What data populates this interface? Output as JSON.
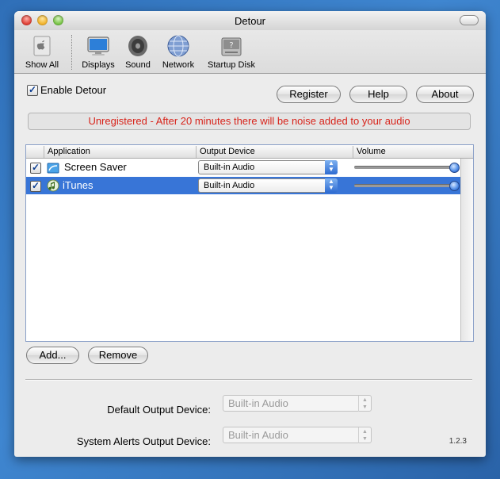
{
  "window": {
    "title": "Detour"
  },
  "toolbar": {
    "items": [
      {
        "label": "Show All",
        "icon": "apple-icon"
      },
      {
        "label": "Displays",
        "icon": "display-icon"
      },
      {
        "label": "Sound",
        "icon": "speaker-icon"
      },
      {
        "label": "Network",
        "icon": "globe-icon"
      },
      {
        "label": "Startup Disk",
        "icon": "disk-icon"
      }
    ]
  },
  "enable": {
    "label": "Enable Detour",
    "checked": true
  },
  "buttons": {
    "register": "Register",
    "help": "Help",
    "about": "About",
    "add": "Add...",
    "remove": "Remove"
  },
  "banner": {
    "text": "Unregistered - After 20 minutes there will be noise added to your audio",
    "color": "#d8231a"
  },
  "table": {
    "columns": [
      "Application",
      "Output Device",
      "Volume"
    ],
    "rows": [
      {
        "checked": true,
        "app": "Screen Saver",
        "device": "Built-in Audio",
        "volume": 1.0,
        "selected": false
      },
      {
        "checked": true,
        "app": "iTunes",
        "device": "Built-in Audio",
        "volume": 1.0,
        "selected": true
      }
    ]
  },
  "defaults": {
    "default_label": "Default Output Device:",
    "default_value": "Built-in Audio",
    "alerts_label": "System Alerts Output Device:",
    "alerts_value": "Built-in Audio"
  },
  "version": "1.2.3",
  "colors": {
    "selection": "#3875d7",
    "accent": "#2d6bd1"
  }
}
